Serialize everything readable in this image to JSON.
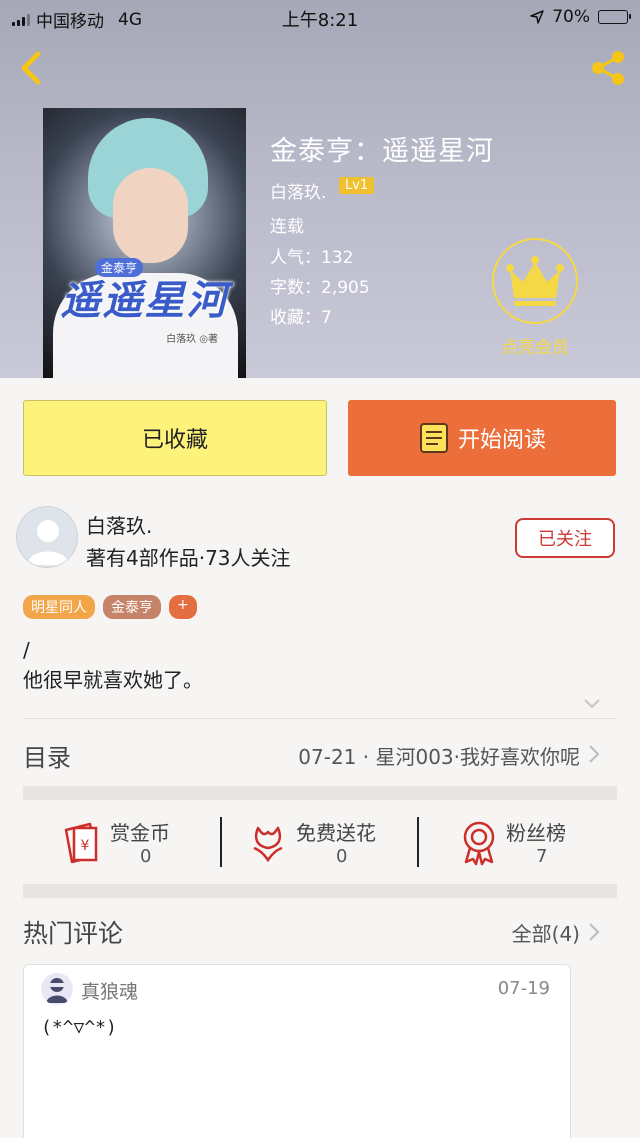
{
  "status_bar": {
    "carrier": "中国移动",
    "network": "4G",
    "time": "上午8:21",
    "battery": "70%",
    "battery_level": 0.7
  },
  "book": {
    "title": "金泰亨：遥遥星河",
    "author": "白落玖.",
    "level": "Lv1",
    "status": "连载",
    "popularity": "人气：132",
    "word_count": "字数：2,905",
    "favorites": "收藏：7",
    "cover_title": "遥遥星河",
    "cover_subtitle": "金泰亨",
    "cover_author": "白落玖 ◎著"
  },
  "vip": {
    "label": "点亮会员"
  },
  "actions": {
    "favorited_label": "已收藏",
    "read_label": "开始阅读"
  },
  "author_card": {
    "name": "白落玖.",
    "stats": "著有4部作品·73人关注",
    "follow_label": "已关注"
  },
  "tags": [
    "明星同人",
    "金泰亨",
    "+"
  ],
  "description": [
    "/",
    "他很早就喜欢她了。"
  ],
  "toc": {
    "label": "目录",
    "latest": "07-21 · 星河003·我好喜欢你呢"
  },
  "stats": [
    {
      "label": "赏金币",
      "value": "0",
      "icon": "red-envelope-icon"
    },
    {
      "label": "免费送花",
      "value": "0",
      "icon": "flower-icon"
    },
    {
      "label": "粉丝榜",
      "value": "7",
      "icon": "medal-icon"
    }
  ],
  "comments": {
    "heading": "热门评论",
    "all_label": "全部(4)",
    "items": [
      {
        "user": "真狼魂",
        "date": "07-19",
        "text": "(*^▽^*)"
      }
    ]
  },
  "colors": {
    "accent_orange": "#ec6f3b",
    "fav_yellow": "#fdf27a",
    "follow_red": "#cc3b33",
    "vip_gold": "#f5d845"
  }
}
